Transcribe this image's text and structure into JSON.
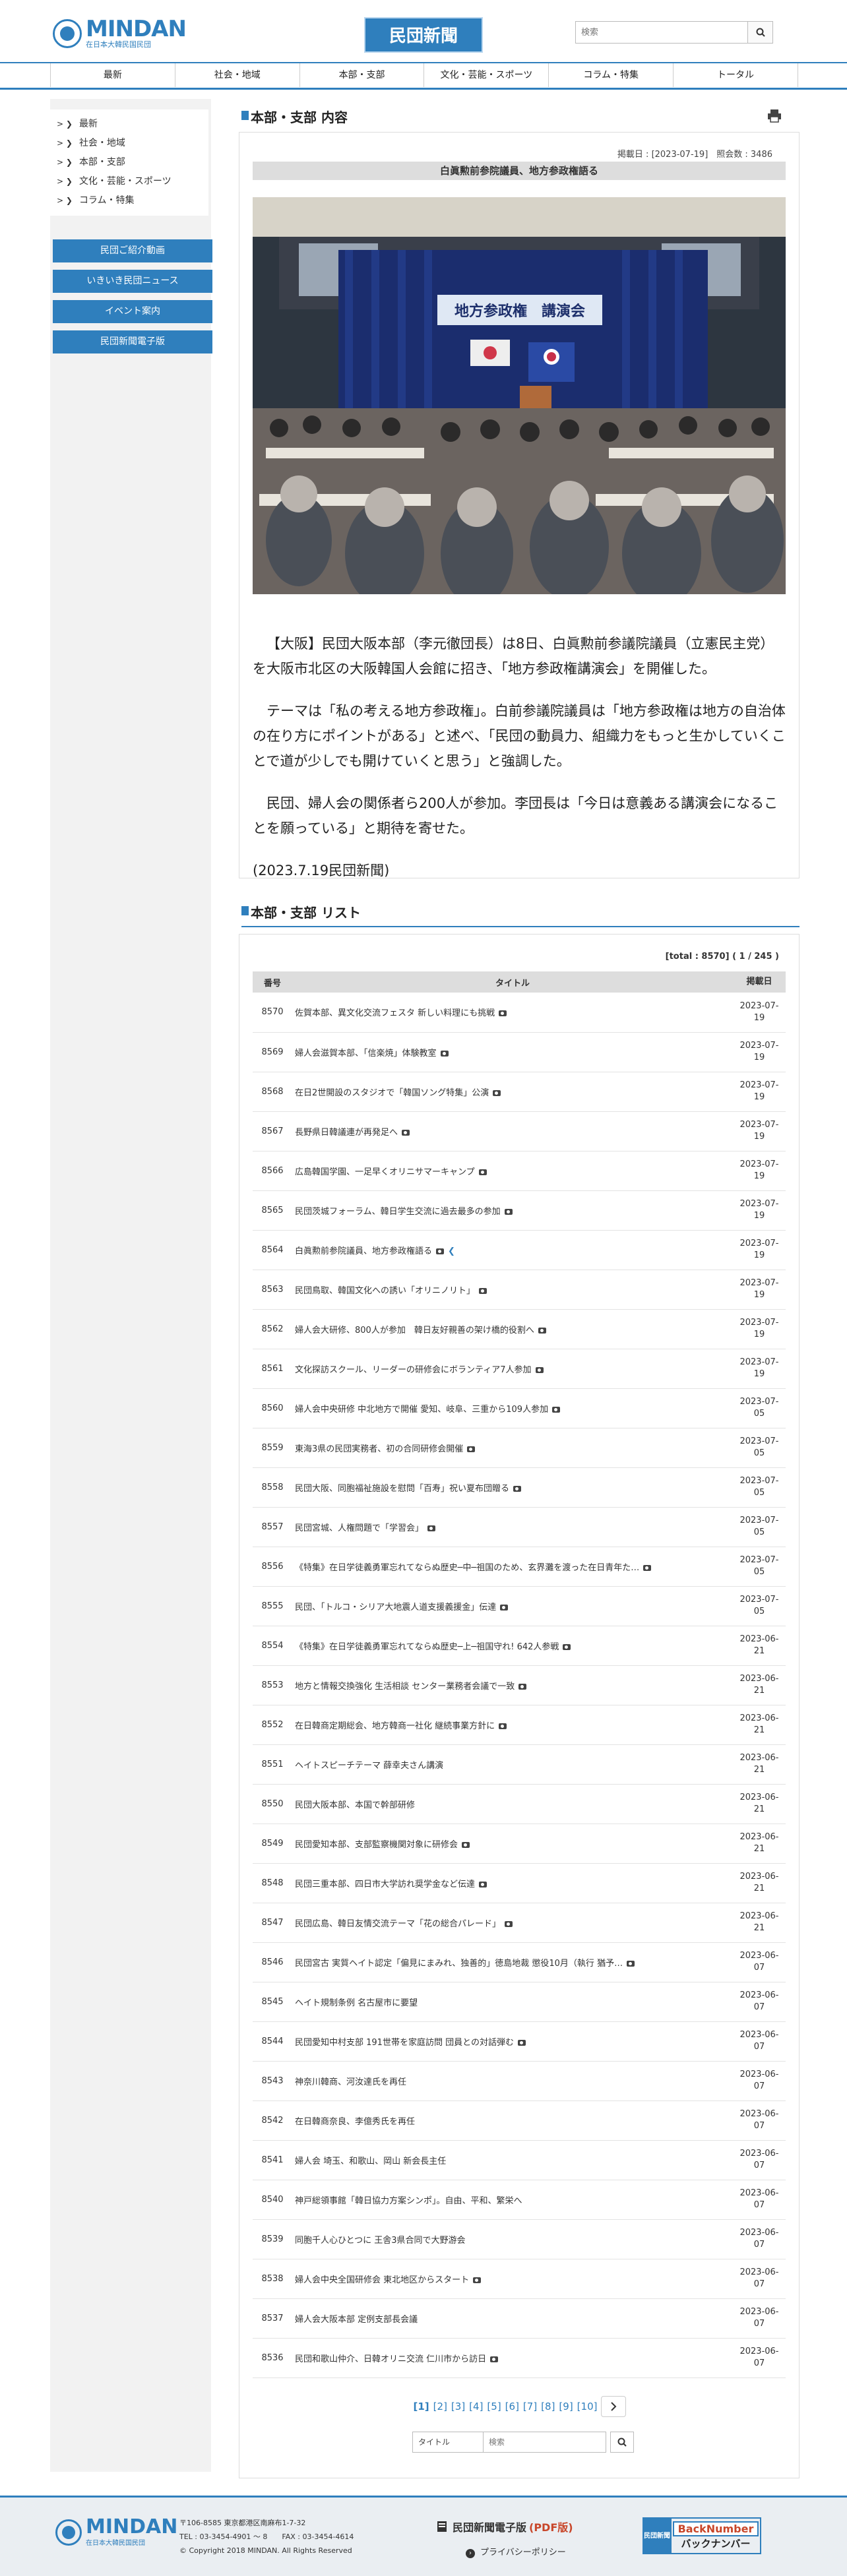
{
  "header": {
    "logo_main": "MINDAN",
    "logo_sub": "在日本大韓民国民団",
    "brand": "民団新聞",
    "search_placeholder": "検索"
  },
  "gnav": [
    "最新",
    "社会・地域",
    "本部・支部",
    "文化・芸能・スポーツ",
    "コラム・特集",
    "トータル"
  ],
  "sidebar": {
    "menu": [
      "最新",
      "社会・地域",
      "本部・支部",
      "文化・芸能・スポーツ",
      "コラム・特集"
    ],
    "buttons": [
      "民団ご紹介動画",
      "いきいき民団ニュース",
      "イベント案内",
      "民団新聞電子版"
    ]
  },
  "article": {
    "section_title": "本部・支部 内容",
    "meta": "掲載日 : [2023-07-19]　照会数 : 3486",
    "headline": "白眞勲前参院議員、地方参政権語る",
    "photo": {
      "banner": "地方参政権　講演会",
      "banner_colors": {
        "panel": "#dfe8f4",
        "text": "#1d2f6b",
        "curtain": "#1b2d6e"
      }
    },
    "paragraphs": [
      "【大阪】民団大阪本部（李元徹団長）は8日、白眞勲前参議院議員（立憲民主党）を大阪市北区の大阪韓国人会館に招き、「地方参政権講演会」を開催した。",
      "テーマは「私の考える地方参政権」。白前参議院議員は「地方参政権は地方の自治体の在り方にポイントがある」と述べ、「民団の動員力、組織力をもっと生かしていくことで道が少しでも開けていくと思う」と強調した。",
      "民団、婦人会の関係者ら200人が参加。李団長は「今日は意義ある講演会になることを願っている」と期待を寄せた。"
    ],
    "dateline": "(2023.7.19民団新聞)"
  },
  "list": {
    "section_title": "本部・支部 リスト",
    "count": "[total : 8570] ( 1 / 245 )",
    "headers": [
      "番号",
      "タイトル",
      "掲載日"
    ],
    "rows": [
      {
        "no": "8570",
        "title": "佐賀本部、異文化交流フェスタ 新しい料理にも挑戦",
        "date": [
          "2023-07-",
          "19"
        ],
        "icon": "camera-icon"
      },
      {
        "no": "8569",
        "title": "婦人会滋賀本部、「信楽焼」体験教室",
        "date": [
          "2023-07-",
          "19"
        ],
        "icon": "camera-icon"
      },
      {
        "no": "8568",
        "title": "在日2世開設のスタジオで「韓国ソング特集」公演",
        "date": [
          "2023-07-",
          "19"
        ],
        "icon": "camera-icon"
      },
      {
        "no": "8567",
        "title": "長野県日韓議連が再発足へ",
        "date": [
          "2023-07-",
          "19"
        ],
        "icon": "camera-icon"
      },
      {
        "no": "8566",
        "title": "広島韓国学園、一足早くオリニサマーキャンプ",
        "date": [
          "2023-07-",
          "19"
        ],
        "icon": "camera-icon"
      },
      {
        "no": "8565",
        "title": "民団茨城フォーラム、韓日学生交流に過去最多の参加",
        "date": [
          "2023-07-",
          "19"
        ],
        "icon": "camera-icon"
      },
      {
        "no": "8564",
        "title": "白眞勲前参院議員、地方参政権語る",
        "date": [
          "2023-07-",
          "19"
        ],
        "icon": "camera-icon",
        "share": "❮"
      },
      {
        "no": "8563",
        "title": "民団鳥取、韓国文化への誘い「オリニノリト」",
        "date": [
          "2023-07-",
          "19"
        ],
        "icon": "camera-icon"
      },
      {
        "no": "8562",
        "title": "婦人会大研修、800人が参加　韓日友好親善の架け橋的役割へ",
        "date": [
          "2023-07-",
          "19"
        ],
        "icon": "camera-icon"
      },
      {
        "no": "8561",
        "title": "文化探訪スクール、リーダーの研修会にボランティア7人参加",
        "date": [
          "2023-07-",
          "19"
        ],
        "icon": "camera-icon"
      },
      {
        "no": "8560",
        "title": "婦人会中央研修 中北地方で開催 愛知、岐阜、三重から109人参加",
        "date": [
          "2023-07-",
          "05"
        ],
        "icon": "camera-icon"
      },
      {
        "no": "8559",
        "title": "東海3県の民団実務者、初の合同研修会開催",
        "date": [
          "2023-07-",
          "05"
        ],
        "icon": "camera-icon"
      },
      {
        "no": "8558",
        "title": "民団大阪、同胞福祉施設を慰問「百寿」祝い夏布団贈る",
        "date": [
          "2023-07-",
          "05"
        ],
        "icon": "camera-icon"
      },
      {
        "no": "8557",
        "title": "民団宮城、人権問題で「学習会」",
        "date": [
          "2023-07-",
          "05"
        ],
        "icon": "camera-icon"
      },
      {
        "no": "8556",
        "title": "《特集》在日学徒義勇軍忘れてならぬ歴史─中─祖国のため、玄界灘を渡った在日青年た…",
        "date": [
          "2023-07-",
          "05"
        ],
        "icon": "camera-icon",
        "wrap": true
      },
      {
        "no": "8555",
        "title": "民団、「トルコ・シリア大地震人道支援義援金」伝達",
        "date": [
          "2023-07-",
          "05"
        ],
        "icon": "camera-icon"
      },
      {
        "no": "8554",
        "title": "《特集》在日学徒義勇軍忘れてならぬ歴史─上─祖国守れ! 642人参戦",
        "date": [
          "2023-06-",
          "21"
        ],
        "icon": "camera-icon"
      },
      {
        "no": "8553",
        "title": "地方と情報交換強化 生活相談 センター業務者会議で一致",
        "date": [
          "2023-06-",
          "21"
        ],
        "icon": "camera-icon"
      },
      {
        "no": "8552",
        "title": "在日韓商定期総会、地方韓商一社化 継続事業方針に",
        "date": [
          "2023-06-",
          "21"
        ],
        "icon": "camera-icon"
      },
      {
        "no": "8551",
        "title": "ヘイトスピーチテーマ 薛幸夫さん講演",
        "date": [
          "2023-06-",
          "21"
        ],
        "icon": ""
      },
      {
        "no": "8550",
        "title": "民団大阪本部、本国で幹部研修",
        "date": [
          "2023-06-",
          "21"
        ],
        "icon": ""
      },
      {
        "no": "8549",
        "title": "民団愛知本部、支部監察機関対象に研修会",
        "date": [
          "2023-06-",
          "21"
        ],
        "icon": "camera-icon"
      },
      {
        "no": "8548",
        "title": "民団三重本部、四日市大学訪れ奨学金など伝達",
        "date": [
          "2023-06-",
          "21"
        ],
        "icon": "camera-icon"
      },
      {
        "no": "8547",
        "title": "民団広島、韓日友情交流テーマ「花の総合パレード」",
        "date": [
          "2023-06-",
          "21"
        ],
        "icon": "camera-icon"
      },
      {
        "no": "8546",
        "title": "民団宮古 実質ヘイト認定「偏見にまみれ、独善的」徳島地裁 懲役10月（執行 猶予…",
        "date": [
          "2023-06-",
          "07"
        ],
        "icon": "camera-icon"
      },
      {
        "no": "8545",
        "title": "ヘイト規制条例 名古屋市に要望",
        "date": [
          "2023-06-",
          "07"
        ],
        "icon": ""
      },
      {
        "no": "8544",
        "title": "民団愛知中村支部 191世帯を家庭訪問 団員との対話弾む",
        "date": [
          "2023-06-",
          "07"
        ],
        "icon": "camera-icon"
      },
      {
        "no": "8543",
        "title": "神奈川韓商、河汝達氏を再任",
        "date": [
          "2023-06-",
          "07"
        ],
        "icon": ""
      },
      {
        "no": "8542",
        "title": "在日韓商奈良、李億秀氏を再任",
        "date": [
          "2023-06-",
          "07"
        ],
        "icon": ""
      },
      {
        "no": "8541",
        "title": "婦人会 埼玉、和歌山、岡山 新会長主任",
        "date": [
          "2023-06-",
          "07"
        ],
        "icon": ""
      },
      {
        "no": "8540",
        "title": "神戸総領事館「韓日協力方案シンポ」。自由、平和、繁栄へ",
        "date": [
          "2023-06-",
          "07"
        ],
        "icon": ""
      },
      {
        "no": "8539",
        "title": "同胞千人心ひとつに 王舎3県合同で大野游会",
        "date": [
          "2023-06-",
          "07"
        ],
        "icon": ""
      },
      {
        "no": "8538",
        "title": "婦人会中央全国研修会 東北地区からスタート",
        "date": [
          "2023-06-",
          "07"
        ],
        "icon": "camera-icon"
      },
      {
        "no": "8537",
        "title": "婦人会大阪本部 定例支部長会議",
        "date": [
          "2023-06-",
          "07"
        ],
        "icon": ""
      },
      {
        "no": "8536",
        "title": "民団和歌山仲介、日韓オリニ交流 仁川市から訪日",
        "date": [
          "2023-06-",
          "07"
        ],
        "icon": "camera-icon"
      }
    ],
    "pager": {
      "current": "[1]",
      "pages": [
        "[2]",
        "[3]",
        "[4]",
        "[5]",
        "[6]",
        "[7]",
        "[8]",
        "[9]",
        "[10]"
      ],
      "next_icon": "chevron-right-icon"
    },
    "search_select": "タイトル",
    "search_placeholder": "検索"
  },
  "footer": {
    "logo_main": "MINDAN",
    "logo_sub": "在日本大韓民国民団",
    "address": "〒106-8585 東京都港区南麻布1-7-32",
    "tel": "TEL : 03-3454-4901 ～ 8　　FAX : 03-3454-4614",
    "copyright": "© Copyright 2018 MINDAN. All Rights Reserved",
    "pdf_label": "民団新聞電子版",
    "pdf_tag": "(PDF版)",
    "privacy": "プライバシーポリシー",
    "backnumber_left": "民団新聞",
    "backnumber_en": "BackNumber",
    "backnumber_jp": "バックナンバー"
  }
}
